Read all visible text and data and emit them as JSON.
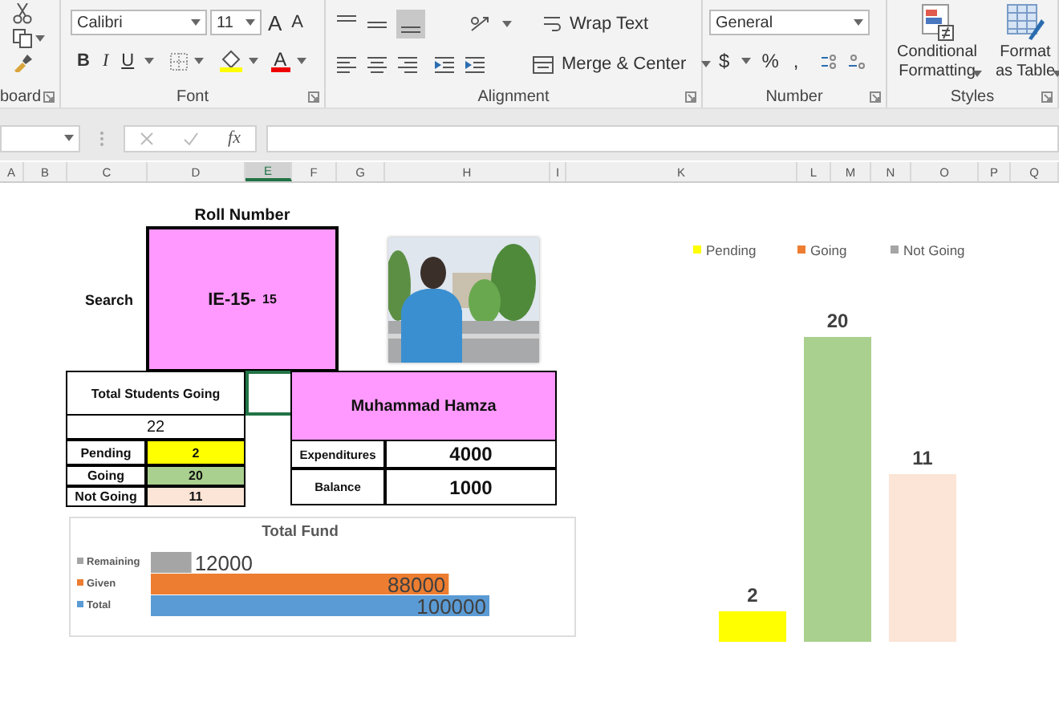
{
  "ribbon": {
    "groups": [
      {
        "kind": "clipboard",
        "label": "board"
      },
      {
        "kind": "font",
        "label": "Font",
        "font_name": "Calibri",
        "font_size": "11",
        "size_buttons": [
          "A",
          "A"
        ],
        "style_buttons": [
          "B",
          "I",
          "U"
        ],
        "font_color_button": "A"
      },
      {
        "kind": "alignment",
        "label": "Alignment",
        "wrap_text": "Wrap Text",
        "merge": "Merge & Center"
      },
      {
        "kind": "number",
        "label": "Number",
        "format": "General",
        "buttons": [
          "$",
          "%",
          ","
        ]
      },
      {
        "kind": "styles",
        "label": "Styles",
        "buttons": [
          "Conditional Formatting",
          "Format as Table"
        ]
      }
    ]
  },
  "formula_bar": {
    "function_label": "fx"
  },
  "columns": [
    {
      "label": "A",
      "selected": false
    },
    {
      "label": "B",
      "selected": false
    },
    {
      "label": "C",
      "selected": false
    },
    {
      "label": "D",
      "selected": false
    },
    {
      "label": "E",
      "selected": true
    },
    {
      "label": "F",
      "selected": false
    },
    {
      "label": "G",
      "selected": false
    },
    {
      "label": "H",
      "selected": false
    },
    {
      "label": "I",
      "selected": false
    },
    {
      "label": "K",
      "selected": false
    },
    {
      "label": "L",
      "selected": false
    },
    {
      "label": "M",
      "selected": false
    },
    {
      "label": "N",
      "selected": false
    },
    {
      "label": "O",
      "selected": false
    },
    {
      "label": "P",
      "selected": false
    },
    {
      "label": "Q",
      "selected": false
    }
  ],
  "sheet": {
    "roll_title": "Roll Number",
    "search_label": "Search",
    "roll_prefix": "IE-15-",
    "roll_value": "15",
    "total_label": "Total Students Going",
    "total": "22",
    "status_rows": [
      {
        "label": "Pending",
        "value": "2",
        "color": "#ffff00"
      },
      {
        "label": "Going",
        "value": "20",
        "color": "#a9d08e"
      },
      {
        "label": "Not Going",
        "value": "11",
        "color": "#fce4d6"
      }
    ],
    "student_name": "Muhammad Hamza",
    "finance_rows": [
      {
        "label": "Expenditures",
        "value": "4000"
      },
      {
        "label": "Balance",
        "value": "1000"
      }
    ],
    "fund_chart": {
      "chart_data": {
        "type": "bar",
        "orientation": "horizontal",
        "title": "Total Fund",
        "legend": "left",
        "data_labels": true,
        "categories": [
          null
        ],
        "series": [
          {
            "name": "Remaining",
            "color": "#a5a5a5",
            "values": [
              12000
            ]
          },
          {
            "name": "Given",
            "color": "#ed7d31",
            "values": [
              88000
            ]
          },
          {
            "name": "Total",
            "color": "#5b9bd5",
            "values": [
              100000
            ]
          }
        ]
      }
    },
    "status_chart": {
      "legend_items": [
        {
          "label": "Pending",
          "color": "#ffff00"
        },
        {
          "label": "Going",
          "color": "#ed7d31"
        },
        {
          "label": "Not Going",
          "color": "#a5a5a5"
        }
      ],
      "chart_data": {
        "type": "bar",
        "orientation": "vertical",
        "data_labels": true,
        "categories": [
          null
        ],
        "series": [
          {
            "color": "#ffff00",
            "values": [
              2
            ]
          },
          {
            "color": "#a9d08e",
            "values": [
              20
            ]
          },
          {
            "color": "#fce4d6",
            "values": [
              11
            ]
          }
        ]
      }
    }
  }
}
